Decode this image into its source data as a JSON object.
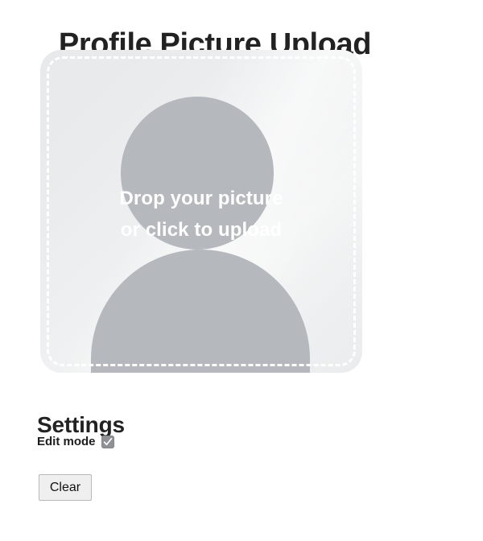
{
  "page": {
    "title": "Profile Picture Upload"
  },
  "dropzone": {
    "name": "profile-picture-dropzone",
    "prompt_line1": "Drop your picture",
    "prompt_line2": "or click to upload",
    "avatar_icon": "user-avatar-placeholder-icon",
    "background_color": "#eceeef",
    "avatar_color": "#b5b8bd",
    "border_style": "dashed",
    "border_color": "#ffffff"
  },
  "settings": {
    "heading": "Settings",
    "edit_mode": {
      "label": "Edit mode",
      "checked": true,
      "check_icon": "checkmark-icon",
      "box_color": "#8f9295"
    },
    "clear_button": {
      "label": "Clear"
    }
  }
}
